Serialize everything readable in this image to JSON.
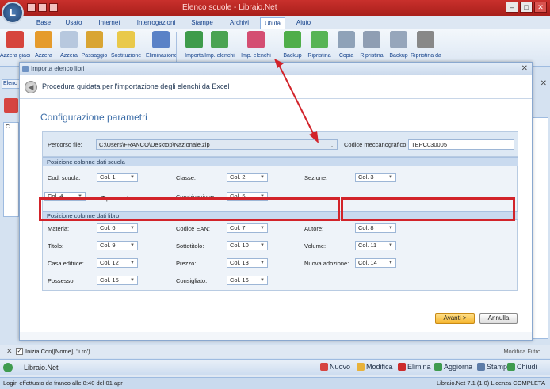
{
  "window": {
    "title": "Elenco scuole - Libraio.Net",
    "controls": [
      "–",
      "□",
      "✕"
    ]
  },
  "ribbon": {
    "tabs": [
      "Base",
      "Usato",
      "Internet",
      "Interrogazioni",
      "Stampe",
      "Archivi",
      "Utilità",
      "Aiuto"
    ],
    "active_tab": "Utilità",
    "buttons": [
      {
        "label": "Azzera giacenze",
        "color": "#d6453d"
      },
      {
        "label": "Azzera",
        "color": "#e59b2c"
      },
      {
        "label": "Azzera",
        "color": "#b7c8de"
      },
      {
        "label": "Passaggio",
        "color": "#d9a533"
      },
      {
        "label": "Sostituzione",
        "color": "#e9c94a"
      },
      {
        "label": "Eliminazione",
        "color": "#5a82c7"
      },
      {
        "label": "Importa",
        "color": "#3e9b4b"
      },
      {
        "label": "Imp. elenchi",
        "color": "#4aa352"
      },
      {
        "label": "Imp. elenchi",
        "color": "#d44e72"
      },
      {
        "label": "Backup",
        "color": "#4fae4a"
      },
      {
        "label": "Ripristina",
        "color": "#57b455"
      },
      {
        "label": "Copia",
        "color": "#8fa2b8"
      },
      {
        "label": "Ripristina",
        "color": "#8f9eb3"
      },
      {
        "label": "Backup",
        "color": "#96a6bb"
      },
      {
        "label": "Ripristina da",
        "color": "#888"
      }
    ]
  },
  "background_window": {
    "tab_label": "Elenc",
    "column_c": "C"
  },
  "dialog": {
    "title": "Importa elenco libri",
    "wizard_title": "Procedura guidata per l'importazione degli elenchi da Excel",
    "section_title": "Configurazione parametri",
    "percorso_label": "Percorso file:",
    "percorso_value": "C:\\Users\\FRANCO\\Desktop\\Nazionale.zip",
    "codice_label": "Codice meccanografico:",
    "codice_value": "TEPC030005",
    "section_scuola": "Posizione colonne dati scuola",
    "section_libro": "Posizione colonne dati libro",
    "scuola_fields": [
      {
        "label": "Cod. scuola:",
        "value": "Col. 1"
      },
      {
        "label": "Classe:",
        "value": "Col. 2"
      },
      {
        "label": "Sezione:",
        "value": "Col. 3"
      },
      {
        "label": "",
        "value": "Col. 4"
      },
      {
        "label": "Tipo scuola:",
        "value": ""
      },
      {
        "label": "Combinazione:",
        "value": "Col. 5"
      }
    ],
    "libro_fields": [
      {
        "label": "Materia:",
        "value": "Col. 6"
      },
      {
        "label": "Codice EAN:",
        "value": "Col. 7"
      },
      {
        "label": "Autore:",
        "value": "Col. 8"
      },
      {
        "label": "Titolo:",
        "value": "Col. 9"
      },
      {
        "label": "Sottotitolo:",
        "value": "Col. 10"
      },
      {
        "label": "Volume:",
        "value": "Col. 11"
      },
      {
        "label": "Casa editrice:",
        "value": "Col. 12"
      },
      {
        "label": "Prezzo:",
        "value": "Col. 13"
      },
      {
        "label": "Nuova adozione:",
        "value": "Col. 14"
      },
      {
        "label": "Possesso:",
        "value": "Col. 15"
      },
      {
        "label": "Consigliato:",
        "value": "Col. 16"
      }
    ],
    "avanti_label": "Avanti >",
    "annulla_label": "Annulla"
  },
  "filter": {
    "text": "Inizia Con([Nome], 'li ro')",
    "edit_label": "Modifica Filtro"
  },
  "bottom": {
    "app_name": "Libraio.Net",
    "buttons": [
      {
        "label": "Nuovo",
        "color": "#d64541"
      },
      {
        "label": "Modifica",
        "color": "#e8b23a"
      },
      {
        "label": "Elimina",
        "color": "#cc2b2b"
      },
      {
        "label": "Aggiorna",
        "color": "#3f9b4f"
      },
      {
        "label": "Stampa",
        "color": "#5c7ca8"
      },
      {
        "label": "Chiudi",
        "color": "#3f9b4f"
      }
    ]
  },
  "status": {
    "left": "Login effettuato da franco alle 8:40 del 01 apr",
    "right": "Libraio.Net 7.1 (1.0) Licenza COMPLETA"
  },
  "colors": {
    "annotation_red": "#d2232a",
    "accent_blue": "#3d6ea8"
  }
}
